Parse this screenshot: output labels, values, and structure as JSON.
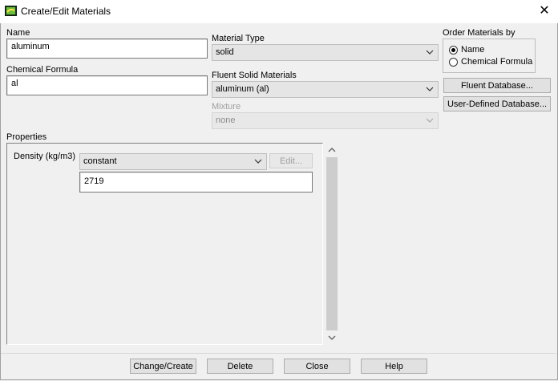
{
  "window": {
    "title": "Create/Edit Materials",
    "close_glyph": "✕"
  },
  "name": {
    "label": "Name",
    "value": "aluminum"
  },
  "chemical_formula": {
    "label": "Chemical Formula",
    "value": "al"
  },
  "material_type": {
    "label": "Material Type",
    "value": "solid"
  },
  "fluent_solid_materials": {
    "label": "Fluent Solid Materials",
    "value": "aluminum (al)"
  },
  "mixture": {
    "label": "Mixture",
    "value": "none"
  },
  "order_by": {
    "label": "Order Materials by",
    "options": [
      {
        "label": "Name",
        "selected": true
      },
      {
        "label": "Chemical Formula",
        "selected": false
      }
    ]
  },
  "side_buttons": {
    "fluent_database": "Fluent Database...",
    "user_defined_database": "User-Defined Database..."
  },
  "properties": {
    "label": "Properties",
    "density": {
      "label": "Density (kg/m3)",
      "method": "constant",
      "edit_label": "Edit...",
      "value": "2719"
    }
  },
  "footer": {
    "change_create": "Change/Create",
    "delete": "Delete",
    "close": "Close",
    "help": "Help"
  },
  "icons": {
    "app": "fluent-app-icon",
    "dropdown": "chevron-down-icon",
    "scroll_up": "chevron-up-icon",
    "scroll_down": "chevron-down-icon"
  }
}
